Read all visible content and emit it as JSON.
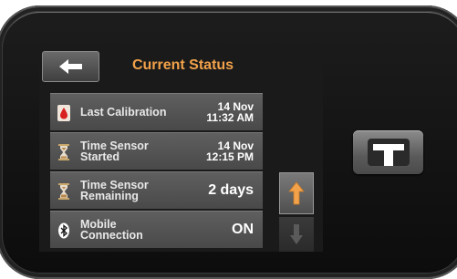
{
  "screen": {
    "title": "Current Status",
    "rows": [
      {
        "icon": "blood-drop-icon",
        "label_lines": [
          "Last Calibration"
        ],
        "value_lines": [
          "14 Nov",
          "11:32 AM"
        ]
      },
      {
        "icon": "hourglass-icon",
        "label_lines": [
          "Time Sensor",
          "Started"
        ],
        "value_lines": [
          "14 Nov",
          "12:15 PM"
        ]
      },
      {
        "icon": "hourglass-icon",
        "label_lines": [
          "Time Sensor",
          "Remaining"
        ],
        "value": "2 days"
      },
      {
        "icon": "bluetooth-icon",
        "label_lines": [
          "Mobile",
          "Connection"
        ],
        "value": "ON"
      }
    ],
    "back_icon": "back-arrow-icon",
    "scroll_up_icon": "up-arrow-icon",
    "scroll_down_icon": "down-arrow-icon"
  },
  "device": {
    "home_button_icon": "t-logo-icon"
  },
  "colors": {
    "title": "#f2a24a",
    "scroll_up_arrow": "#f2a24a",
    "drop": "#d82020"
  }
}
